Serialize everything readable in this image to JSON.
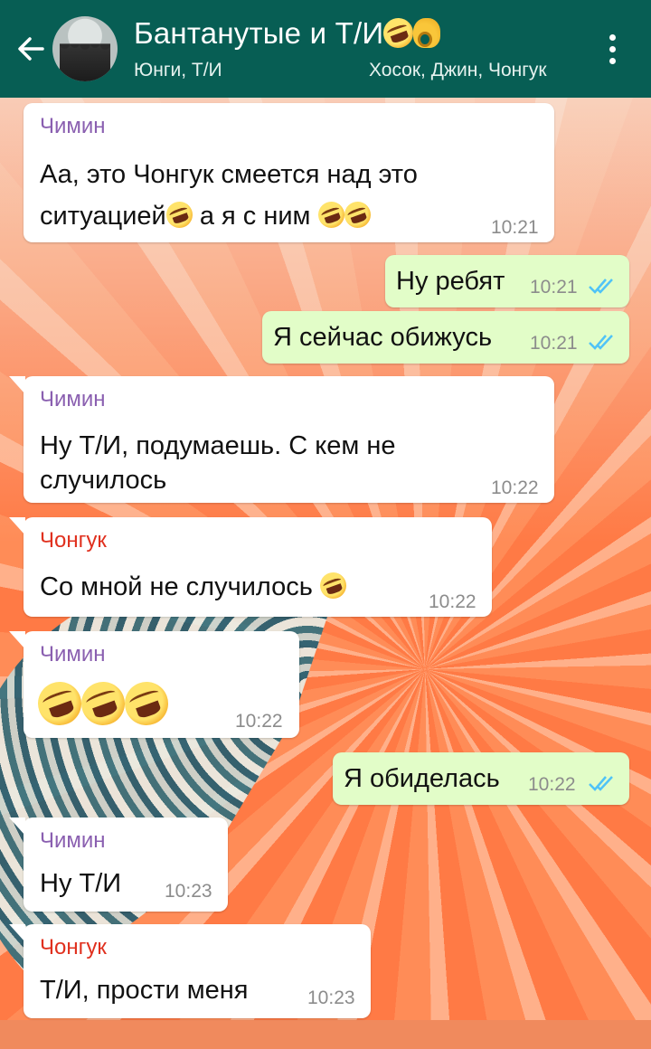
{
  "header": {
    "title": "Бантанутые и Т/И",
    "subtitle_part1": "Юнги, Т/И",
    "subtitle_part2": "Хосок, Джин, Чонгук",
    "icons": [
      "back-arrow-icon",
      "group-avatar",
      "more-vert-icon"
    ],
    "bar_color": "#075e54"
  },
  "messages": [
    {
      "direction": "in",
      "sender": "Чимин",
      "text_line1": "Аа, это Чонгук смеется над это",
      "text_line2": "ситуацией",
      "text_line2b": "а я с ним",
      "time": "10:21"
    },
    {
      "direction": "out",
      "text": "Ну ребят",
      "time": "10:21",
      "status": "read"
    },
    {
      "direction": "out",
      "text": "Я сейчас обижусь",
      "time": "10:21",
      "status": "read"
    },
    {
      "direction": "in",
      "sender": "Чимин",
      "text_line1": "Ну Т/И, подумаешь. С кем не",
      "text_line2": "случилось",
      "time": "10:22"
    },
    {
      "direction": "in",
      "sender": "Чонгук",
      "text": "Со мной не случилось",
      "time": "10:22"
    },
    {
      "direction": "in",
      "sender": "Чимин",
      "text": "",
      "time": "10:22"
    },
    {
      "direction": "out",
      "text": "Я обиделась",
      "time": "10:22",
      "status": "read"
    },
    {
      "direction": "in",
      "sender": "Чимин",
      "text": "Ну Т/И",
      "time": "10:23"
    },
    {
      "direction": "in",
      "sender": "Чонгук",
      "text": "Т/И, прости меня",
      "time": "10:23"
    }
  ],
  "colors": {
    "incoming_bubble": "#ffffff",
    "outgoing_bubble": "#e2fdc8",
    "read_ticks": "#4fc3f7",
    "sender_chimin": "#8a5fb0",
    "sender_chongguk": "#e0301e"
  }
}
